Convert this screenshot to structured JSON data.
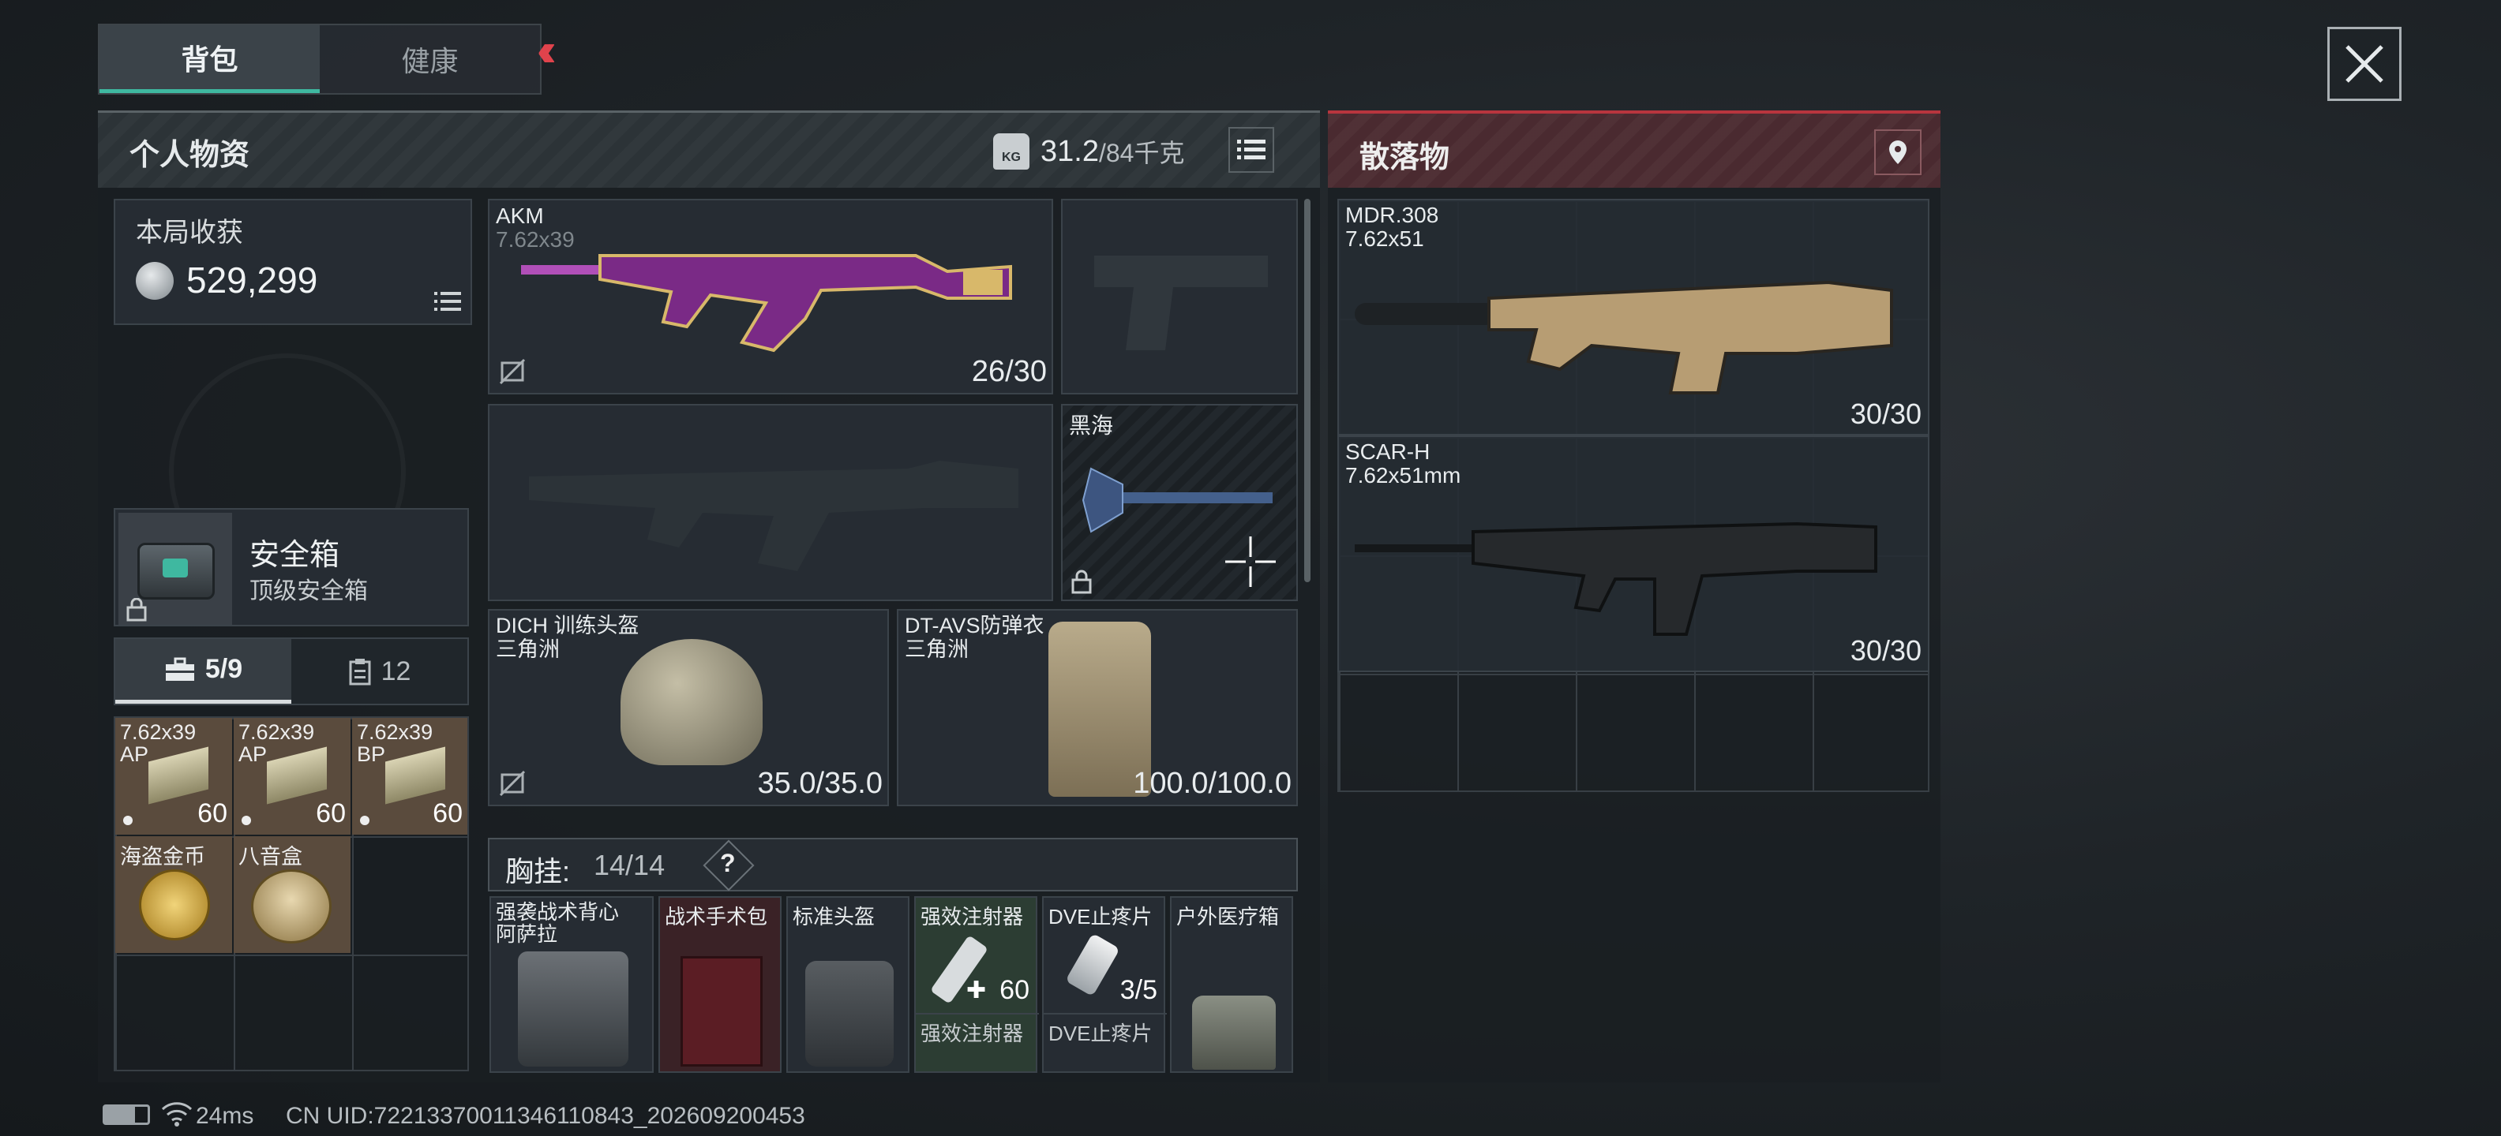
{
  "tabs": [
    {
      "label": "背包",
      "active": true
    },
    {
      "label": "健康",
      "active": false
    }
  ],
  "accent_red": "#e0434c",
  "accent_teal": "#3fb8a0",
  "personal": {
    "title": "个人物资",
    "weight_current": "31.2",
    "weight_max": "/84千克",
    "weight_icon_text": "KG",
    "earnings_label": "本局收获",
    "earnings_value": "529,299",
    "safe_box_title": "安全箱",
    "safe_box_subtitle": "顶级安全箱",
    "container_tabs": [
      {
        "label": "5/9",
        "icon": "toolbox-icon",
        "active": true
      },
      {
        "label": "12",
        "icon": "clipboard-icon",
        "active": false
      }
    ],
    "container_items": [
      {
        "name": "7.62x39",
        "sub": "AP",
        "count": "60"
      },
      {
        "name": "7.62x39",
        "sub": "AP",
        "count": "60"
      },
      {
        "name": "7.62x39",
        "sub": "BP",
        "count": "60"
      },
      {
        "name": "海盗金币",
        "sub": "",
        "count": ""
      },
      {
        "name": "八音盒",
        "sub": "",
        "count": ""
      }
    ]
  },
  "equipment": {
    "primary_weapon": {
      "name": "AKM",
      "caliber": "7.62x39",
      "ammo": "26/30"
    },
    "melee": {
      "name": "黑海"
    },
    "helmet": {
      "name": "DICH 训练头盔",
      "sub": "三角洲",
      "durability": "35.0/35.0"
    },
    "armor": {
      "name": "DT-AVS防弹衣",
      "sub": "三角洲",
      "durability": "100.0/100.0"
    },
    "chest_rig": {
      "label": "胸挂:",
      "capacity": "14/14",
      "help": "?"
    },
    "rig_items": [
      {
        "name": "强袭战术背心",
        "sub": "阿萨拉",
        "count": ""
      },
      {
        "name": "战术手术包",
        "sub": "",
        "count": ""
      },
      {
        "name": "标准头盔",
        "sub": "",
        "count": ""
      },
      {
        "name": "强效注射器",
        "sub": "",
        "count": "60",
        "name2": "强效注射器"
      },
      {
        "name": "DVE止疼片",
        "sub": "",
        "count": "3/5",
        "name2": "DVE止疼片"
      },
      {
        "name": "户外医疗箱",
        "sub": "",
        "count": ""
      }
    ]
  },
  "loot": {
    "title": "散落物",
    "items": [
      {
        "name": "MDR.308",
        "caliber": "7.62x51",
        "ammo": "30/30"
      },
      {
        "name": "SCAR-H",
        "caliber": "7.62x51mm",
        "ammo": "30/30"
      }
    ]
  },
  "status_bar": {
    "ping": "24ms",
    "uid": "CN UID:72213370011346110843_202609200453"
  }
}
